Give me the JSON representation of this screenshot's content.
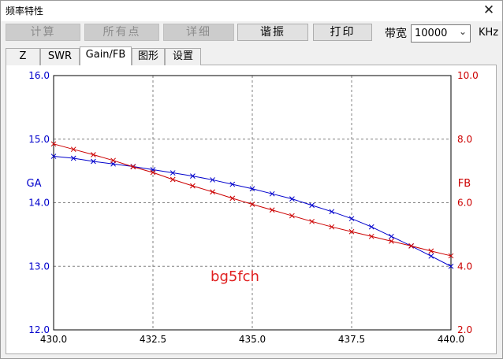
{
  "window": {
    "title": "频率特性",
    "close_icon": "close-icon"
  },
  "toolbar": {
    "calc_label": "计算",
    "all_points_label": "所有点",
    "detail_label": "详细",
    "resonance_label": "谐振",
    "print_label": "打印",
    "bandwidth_label": "带宽",
    "bandwidth_value": "10000",
    "bandwidth_unit": "KHz"
  },
  "tabs": [
    {
      "label": "Z"
    },
    {
      "label": "SWR"
    },
    {
      "label": "Gain/FB"
    },
    {
      "label": "图形"
    },
    {
      "label": "设置"
    }
  ],
  "watermark": "bg5fch",
  "chart_data": {
    "type": "line",
    "x": [
      430.0,
      430.5,
      431.0,
      431.5,
      432.0,
      432.5,
      433.0,
      433.5,
      434.0,
      434.5,
      435.0,
      435.5,
      436.0,
      436.5,
      437.0,
      437.5,
      438.0,
      438.5,
      439.0,
      439.5,
      440.0
    ],
    "xlim": [
      430.0,
      440.0
    ],
    "x_ticks": [
      "430.0",
      "432.5",
      "435.0",
      "437.5",
      "440.0"
    ],
    "left_axis": {
      "label": "GA",
      "ylim": [
        12.0,
        16.0
      ],
      "ticks": [
        "12.0",
        "13.0",
        "14.0",
        "15.0",
        "16.0"
      ],
      "color": "#0000cc"
    },
    "right_axis": {
      "label": "FB",
      "ylim": [
        2.0,
        10.0
      ],
      "ticks": [
        "2.0",
        "4.0",
        "6.0",
        "8.0",
        "10.0"
      ],
      "color": "#cc0000"
    },
    "grid": true,
    "series": [
      {
        "axis": "left",
        "color": "#0000cc",
        "values": [
          14.73,
          14.7,
          14.65,
          14.61,
          14.57,
          14.52,
          14.47,
          14.42,
          14.36,
          14.29,
          14.22,
          14.14,
          14.06,
          13.96,
          13.86,
          13.75,
          13.62,
          13.47,
          13.32,
          13.16,
          13.0
        ]
      },
      {
        "axis": "right",
        "color": "#cc0000",
        "values": [
          7.85,
          7.68,
          7.51,
          7.33,
          7.13,
          6.95,
          6.73,
          6.53,
          6.34,
          6.14,
          5.95,
          5.77,
          5.59,
          5.41,
          5.24,
          5.09,
          4.94,
          4.79,
          4.64,
          4.48,
          4.33
        ]
      }
    ]
  }
}
